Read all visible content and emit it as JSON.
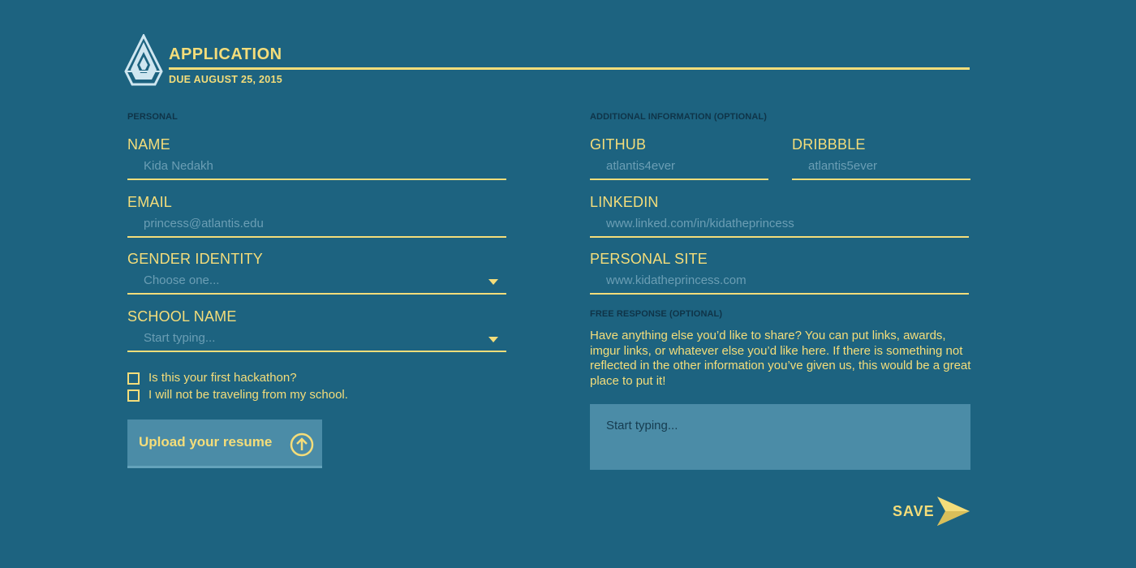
{
  "header": {
    "title": "APPLICATION",
    "due": "DUE AUGUST 25, 2015"
  },
  "personal": {
    "section_label": "PERSONAL",
    "name": {
      "label": "NAME",
      "placeholder": "Kida Nedakh"
    },
    "email": {
      "label": "EMAIL",
      "placeholder": "princess@atlantis.edu"
    },
    "gender": {
      "label": "GENDER IDENTITY",
      "placeholder": "Choose one..."
    },
    "school": {
      "label": "SCHOOL NAME",
      "placeholder": "Start typing..."
    },
    "checkboxes": [
      {
        "label": "Is this your first hackathon?",
        "checked": false
      },
      {
        "label": "I will not be traveling from my school.",
        "checked": false
      }
    ],
    "upload_label": "Upload your resume",
    "upload_icon": "arrow-up-circle-icon"
  },
  "additional": {
    "section_label": "ADDITIONAL INFORMATION (OPTIONAL)",
    "github": {
      "label": "GITHUB",
      "placeholder": "atlantis4ever"
    },
    "dribbble": {
      "label": "DRIBBBLE",
      "placeholder": "atlantis5ever"
    },
    "linkedin": {
      "label": "LINKEDIN",
      "placeholder": "www.linked.com/in/kidatheprincess"
    },
    "site": {
      "label": "PERSONAL SITE",
      "placeholder": "www.kidatheprincess.com"
    },
    "free_label": "FREE RESPONSE (OPTIONAL)",
    "free_prompt": "Have anything else you’d like to share? You can put links, awards, imgur links, or whatever else you’d like here. If there is something not reflected in the other information you’ve given us, this would be a great place to put it!",
    "free_placeholder": "Start typing..."
  },
  "footer": {
    "save_label": "SAVE",
    "save_icon": "paper-plane-arrow-icon"
  },
  "colors": {
    "background": "#1d6380",
    "accent": "#f4dd7a",
    "panel": "#4b8ca7"
  }
}
